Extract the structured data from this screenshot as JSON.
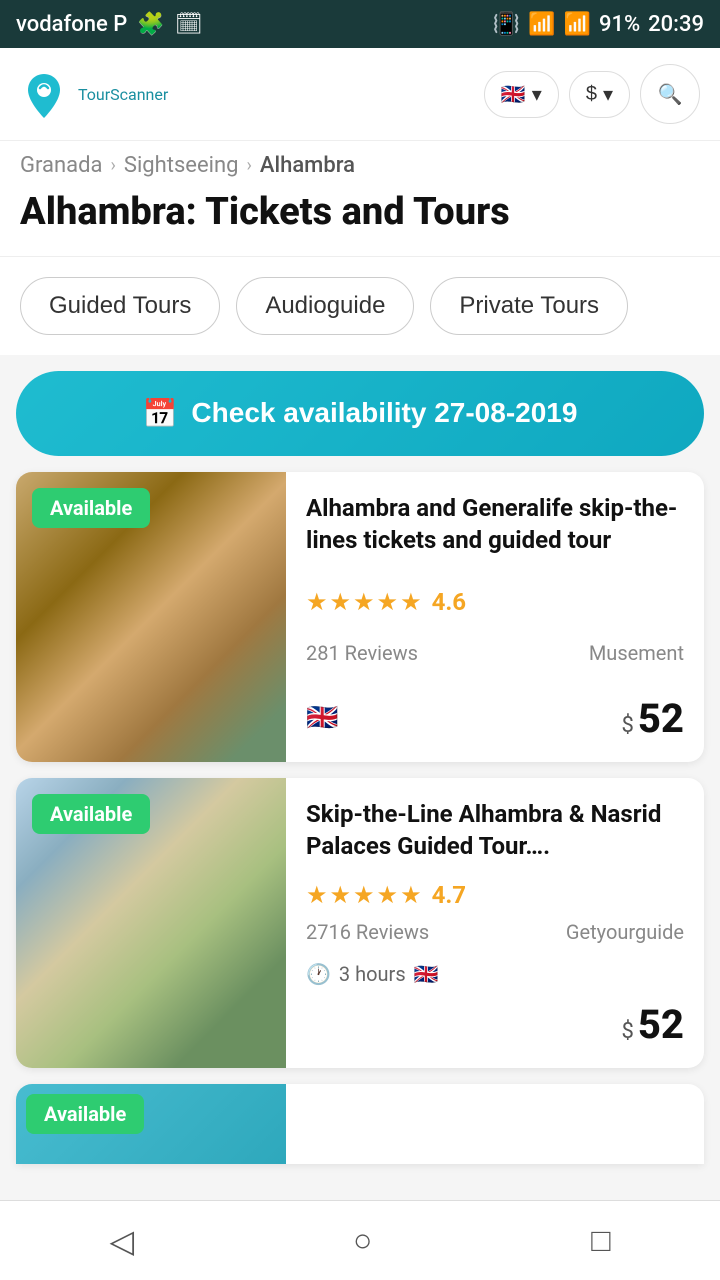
{
  "statusBar": {
    "carrier": "vodafone P",
    "battery": "91%",
    "time": "20:39"
  },
  "header": {
    "logo": "TourScanner",
    "logo_tour": "Tour",
    "logo_scanner": "Scanner",
    "lang_flag": "🇬🇧",
    "currency": "$",
    "chevron": "▾"
  },
  "breadcrumb": {
    "items": [
      "Granada",
      "Sightseeing",
      "Alhambra"
    ]
  },
  "pageTitle": "Alhambra: Tickets and Tours",
  "filters": {
    "chips": [
      "Guided Tours",
      "Audioguide",
      "Private Tours"
    ]
  },
  "availabilityBtn": {
    "label": "Check availability 27-08-2019",
    "icon": "📅"
  },
  "tours": [
    {
      "available": "Available",
      "title": "Alhambra and Generalife skip-the-lines tickets and guided tour",
      "rating": "4.6",
      "reviews": "281 Reviews",
      "provider": "Musement",
      "flag": "🇬🇧",
      "price": "52",
      "currency": "$",
      "duration": null
    },
    {
      "available": "Available",
      "title": "Skip-the-Line Alhambra & Nasrid Palaces Guided Tour….",
      "rating": "4.7",
      "reviews": "2716 Reviews",
      "provider": "Getyourguide",
      "flag": "🇬🇧",
      "price": "52",
      "currency": "$",
      "duration": "3 hours"
    }
  ],
  "partialCard": {
    "available": "Available"
  },
  "bottomNav": {
    "back": "◁",
    "home": "○",
    "square": "□"
  }
}
